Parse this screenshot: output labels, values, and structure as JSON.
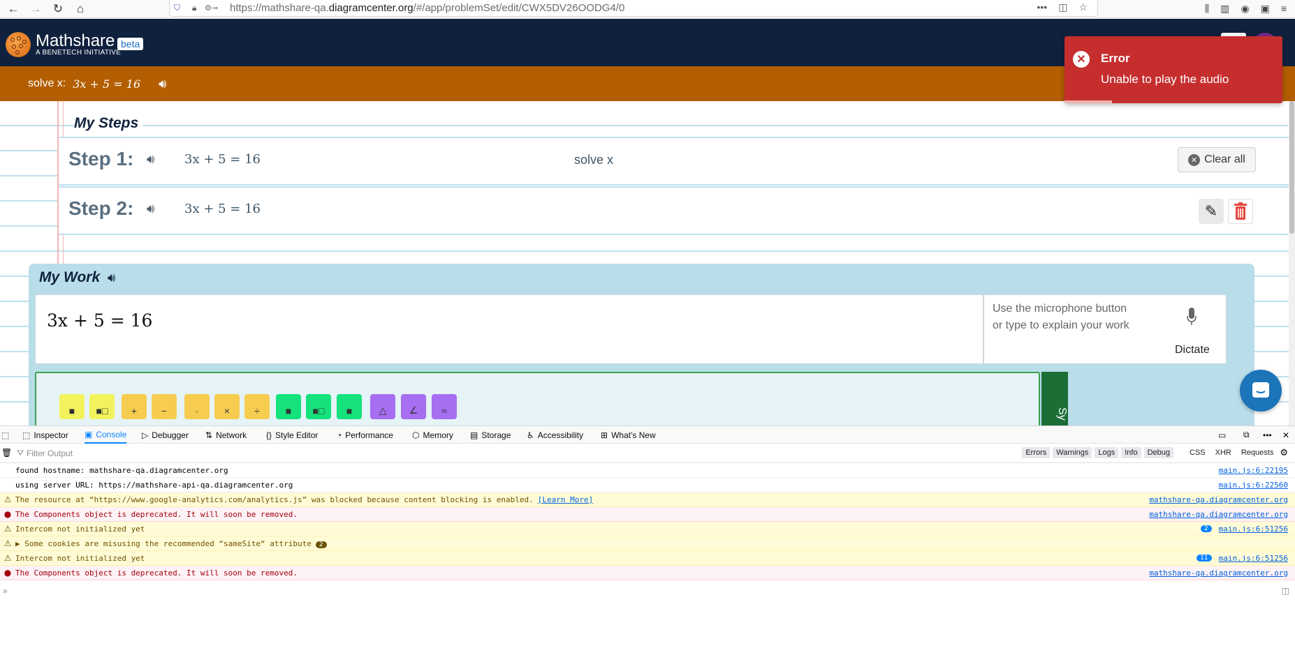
{
  "browser": {
    "url_prefix": "https://mathshare-qa.",
    "url_domain": "diagramcenter.org",
    "url_path": "/#/app/problemSet/edit/CWX5DV26OODG4/0"
  },
  "app": {
    "brand": "Mathshare",
    "subbrand": "A BENETECH INITIATIVE",
    "badge": "beta"
  },
  "problem": {
    "label": "solve x:",
    "equation": "3x + 5 = 16"
  },
  "steps": {
    "title": "My Steps",
    "items": [
      {
        "label": "Step 1:",
        "equation": "3x + 5 = 16",
        "reason": "solve x"
      },
      {
        "label": "Step 2:",
        "equation": "3x + 5 = 16",
        "reason": ""
      }
    ],
    "clear_all": "Clear all"
  },
  "work": {
    "title": "My Work",
    "equation": "3x + 5 = 16",
    "explain_placeholder": "Use the microphone button or type to explain your work",
    "dictate": "Dictate",
    "side_tab": "Sy",
    "palette": [
      {
        "symbol": "■",
        "color": "#f2f25c"
      },
      {
        "symbol": "■□",
        "color": "#f2f25c"
      },
      {
        "symbol": "+",
        "color": "#f6cd4f"
      },
      {
        "symbol": "−",
        "color": "#f6cd4f"
      },
      {
        "symbol": "·",
        "color": "#f6cd4f"
      },
      {
        "symbol": "×",
        "color": "#f6cd4f"
      },
      {
        "symbol": "÷",
        "color": "#f6cd4f"
      },
      {
        "symbol": "■",
        "color": "#15e27c"
      },
      {
        "symbol": "■□",
        "color": "#15e27c"
      },
      {
        "symbol": "■",
        "color": "#15e27c"
      },
      {
        "symbol": "△",
        "color": "#a66ef0"
      },
      {
        "symbol": "∠",
        "color": "#a66ef0"
      },
      {
        "symbol": "≈",
        "color": "#a66ef0"
      }
    ]
  },
  "toast": {
    "title": "Error",
    "message": "Unable to play the audio"
  },
  "devtools": {
    "tabs": [
      "Inspector",
      "Console",
      "Debugger",
      "Network",
      "Style Editor",
      "Performance",
      "Memory",
      "Storage",
      "Accessibility",
      "What's New"
    ],
    "active_tab": "Console",
    "filter_placeholder": "Filter Output",
    "filters": [
      "Errors",
      "Warnings",
      "Logs",
      "Info",
      "Debug"
    ],
    "filters2": [
      "CSS",
      "XHR",
      "Requests"
    ],
    "logs": [
      {
        "type": "log",
        "message": "found hostname: mathshare-qa.diagramcenter.org",
        "source": "main.js:6:22195",
        "count": "",
        "link": ""
      },
      {
        "type": "log",
        "message": "using server URL: https://mathshare-api-qa.diagramcenter.org",
        "source": "main.js:6:22560",
        "count": "",
        "link": ""
      },
      {
        "type": "warn",
        "message": "The resource at “https://www.google-analytics.com/analytics.js” was blocked because content blocking is enabled.",
        "source": "mathshare-qa.diagramcenter.org",
        "count": "",
        "link": "[Learn More]"
      },
      {
        "type": "err",
        "message": "The Components object is deprecated. It will soon be removed.",
        "source": "mathshare-qa.diagramcenter.org",
        "count": "",
        "link": ""
      },
      {
        "type": "warn",
        "message": "Intercom not initialized yet",
        "source": "main.js:6:51256",
        "count": "2",
        "link": ""
      },
      {
        "type": "warn",
        "message": "▶ Some cookies are misusing the recommended “sameSite“ attribute",
        "source": "",
        "count": "",
        "link": "",
        "group": "2"
      },
      {
        "type": "warn",
        "message": "Intercom not initialized yet",
        "source": "main.js:6:51256",
        "count": "11",
        "link": ""
      },
      {
        "type": "err",
        "message": "The Components object is deprecated. It will soon be removed.",
        "source": "mathshare-qa.diagramcenter.org",
        "count": "",
        "link": ""
      }
    ]
  }
}
